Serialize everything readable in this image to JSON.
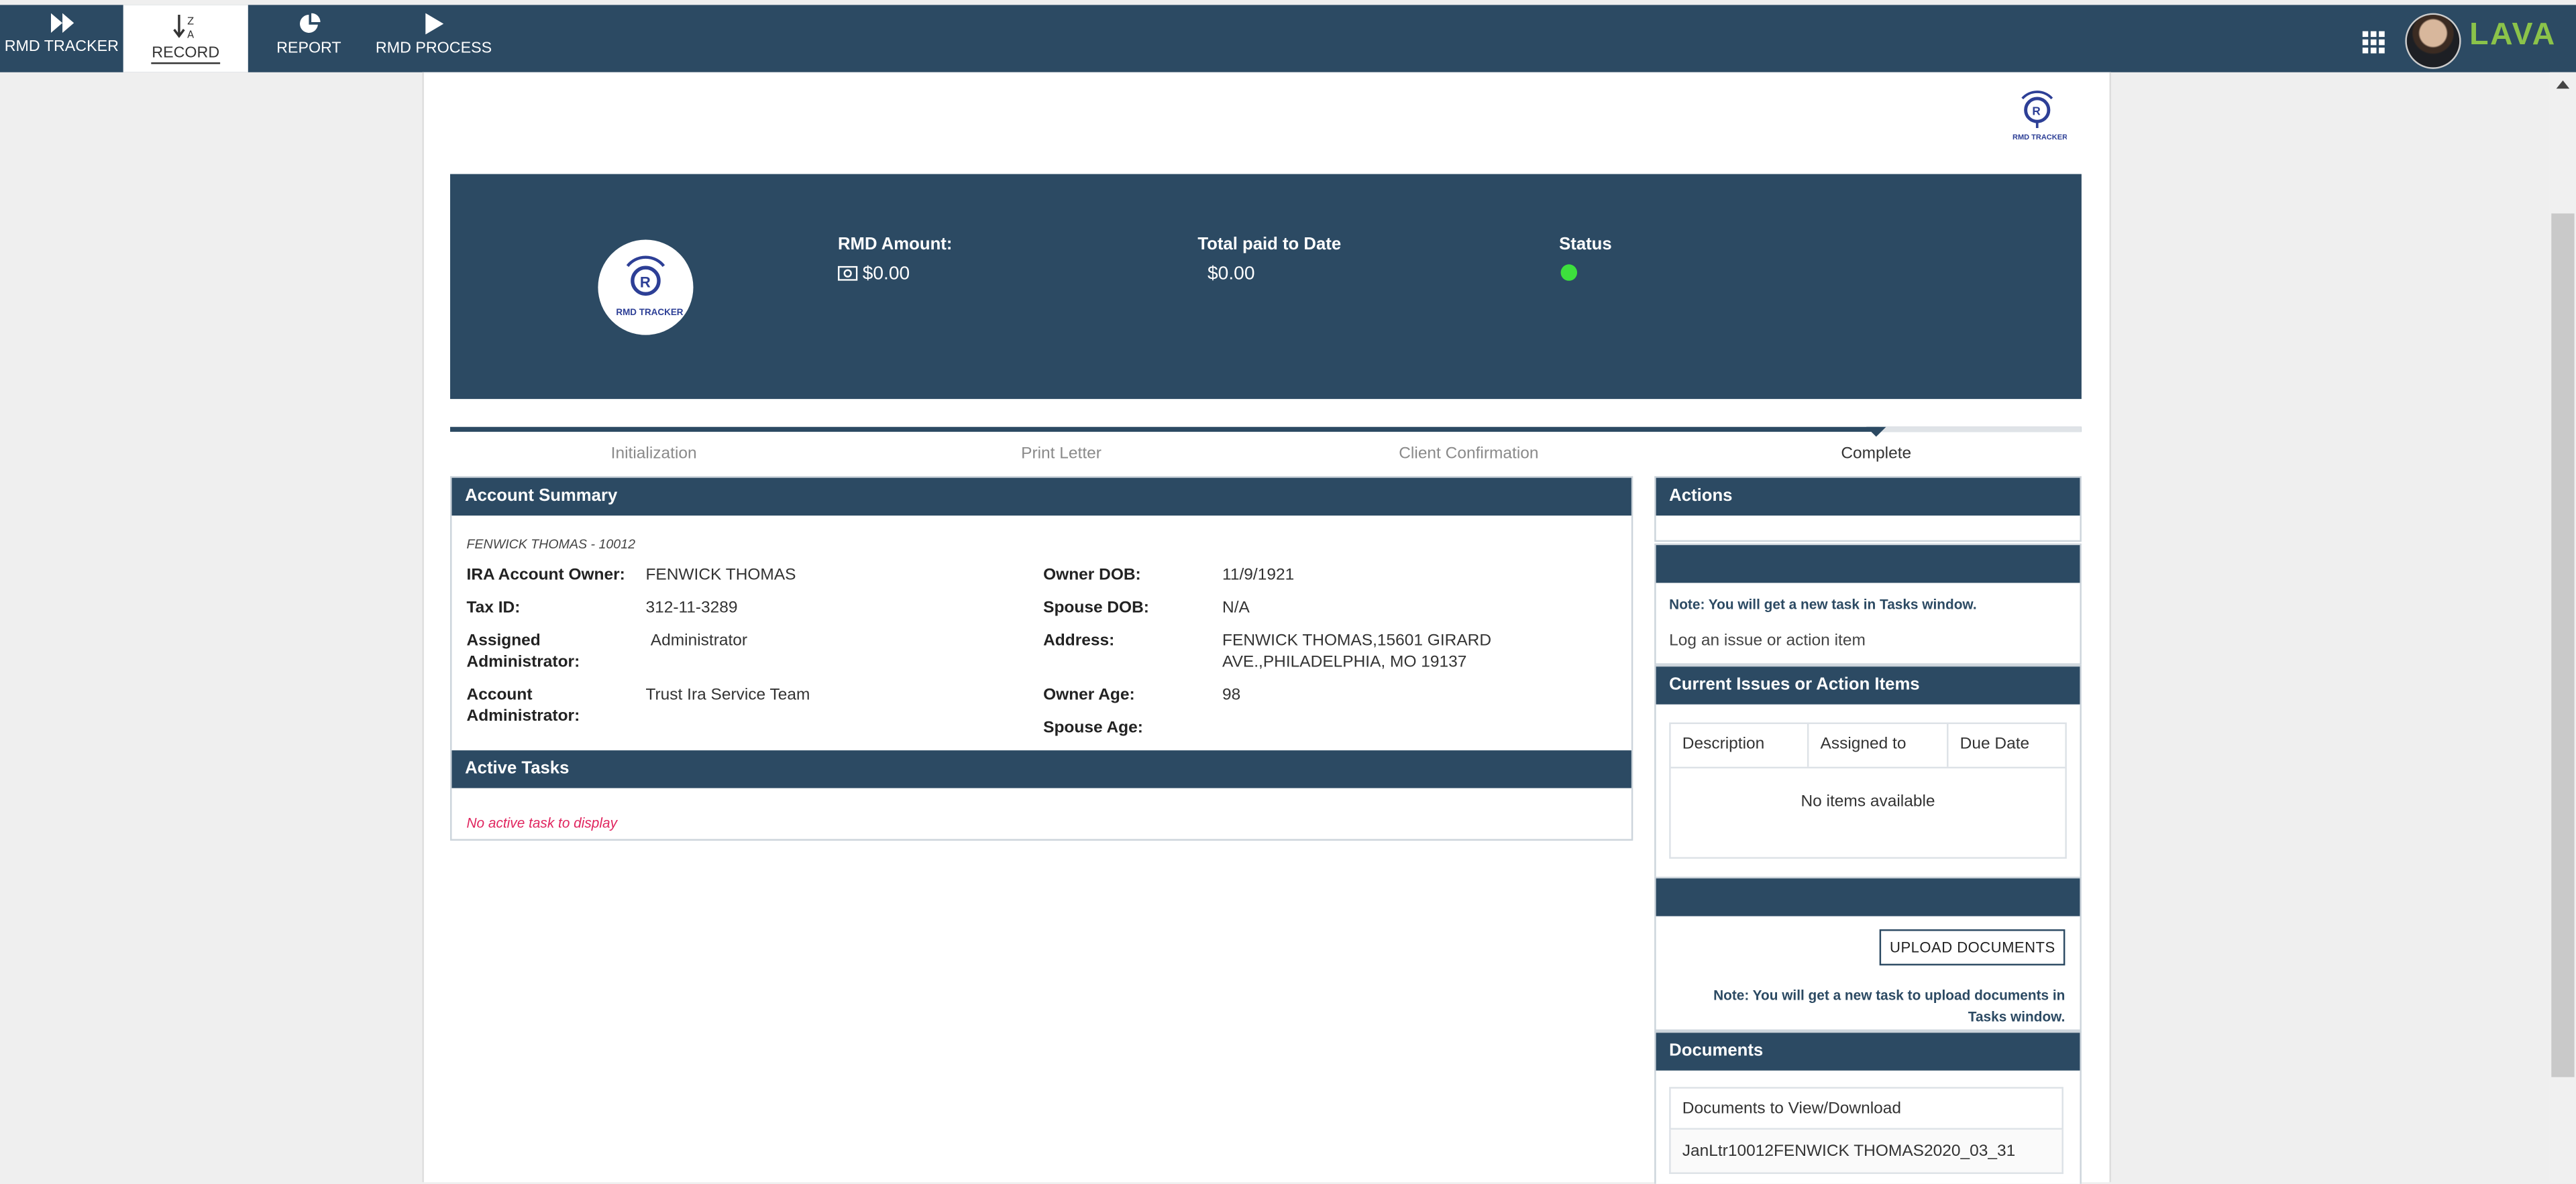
{
  "nav": {
    "items": [
      {
        "label": "RMD TRACKER"
      },
      {
        "label": "RECORD"
      },
      {
        "label": "REPORT"
      },
      {
        "label": "RMD PROCESS"
      }
    ],
    "brand": "LAVA"
  },
  "logo_text": "RMD TRACKER",
  "hero": {
    "rmd_amount_label": "RMD Amount:",
    "rmd_amount_value": "$0.00",
    "total_paid_label": "Total paid to Date",
    "total_paid_value": "$0.00",
    "status_label": "Status",
    "status_color": "#3de03d"
  },
  "steps": [
    "Initialization",
    "Print Letter",
    "Client Confirmation",
    "Complete"
  ],
  "account_summary": {
    "title": "Account Summary",
    "account_id": "FENWICK THOMAS - 10012",
    "ira_owner_label": "IRA Account Owner:",
    "ira_owner_value": "FENWICK THOMAS",
    "tax_id_label": "Tax ID:",
    "tax_id_value": "312-11-3289",
    "assigned_admin_label": "Assigned Administrator:",
    "assigned_admin_value": "Administrator",
    "account_admin_label": "Account Administrator:",
    "account_admin_value": "Trust Ira Service Team",
    "owner_dob_label": "Owner DOB:",
    "owner_dob_value": "11/9/1921",
    "spouse_dob_label": "Spouse DOB:",
    "spouse_dob_value": "N/A",
    "address_label": "Address:",
    "address_value": "FENWICK THOMAS,15601 GIRARD AVE.,PHILADELPHIA, MO 19137",
    "owner_age_label": "Owner Age:",
    "owner_age_value": "98",
    "spouse_age_label": "Spouse Age:",
    "spouse_age_value": ""
  },
  "active_tasks": {
    "title": "Active Tasks",
    "empty": "No active task to display"
  },
  "actions": {
    "title": "Actions",
    "note": "Note: You will get a new task in Tasks window.",
    "log_link": "Log an issue or action item"
  },
  "issues": {
    "title": "Current Issues or Action Items",
    "columns": [
      "Description",
      "Assigned to",
      "Due Date"
    ],
    "empty": "No items available"
  },
  "upload": {
    "button": "UPLOAD DOCUMENTS",
    "note": "Note: You will get a new task to upload documents in Tasks window."
  },
  "documents": {
    "title": "Documents",
    "subheader": "Documents to View/Download",
    "items": [
      "JanLtr10012FENWICK THOMAS2020_03_31"
    ]
  }
}
